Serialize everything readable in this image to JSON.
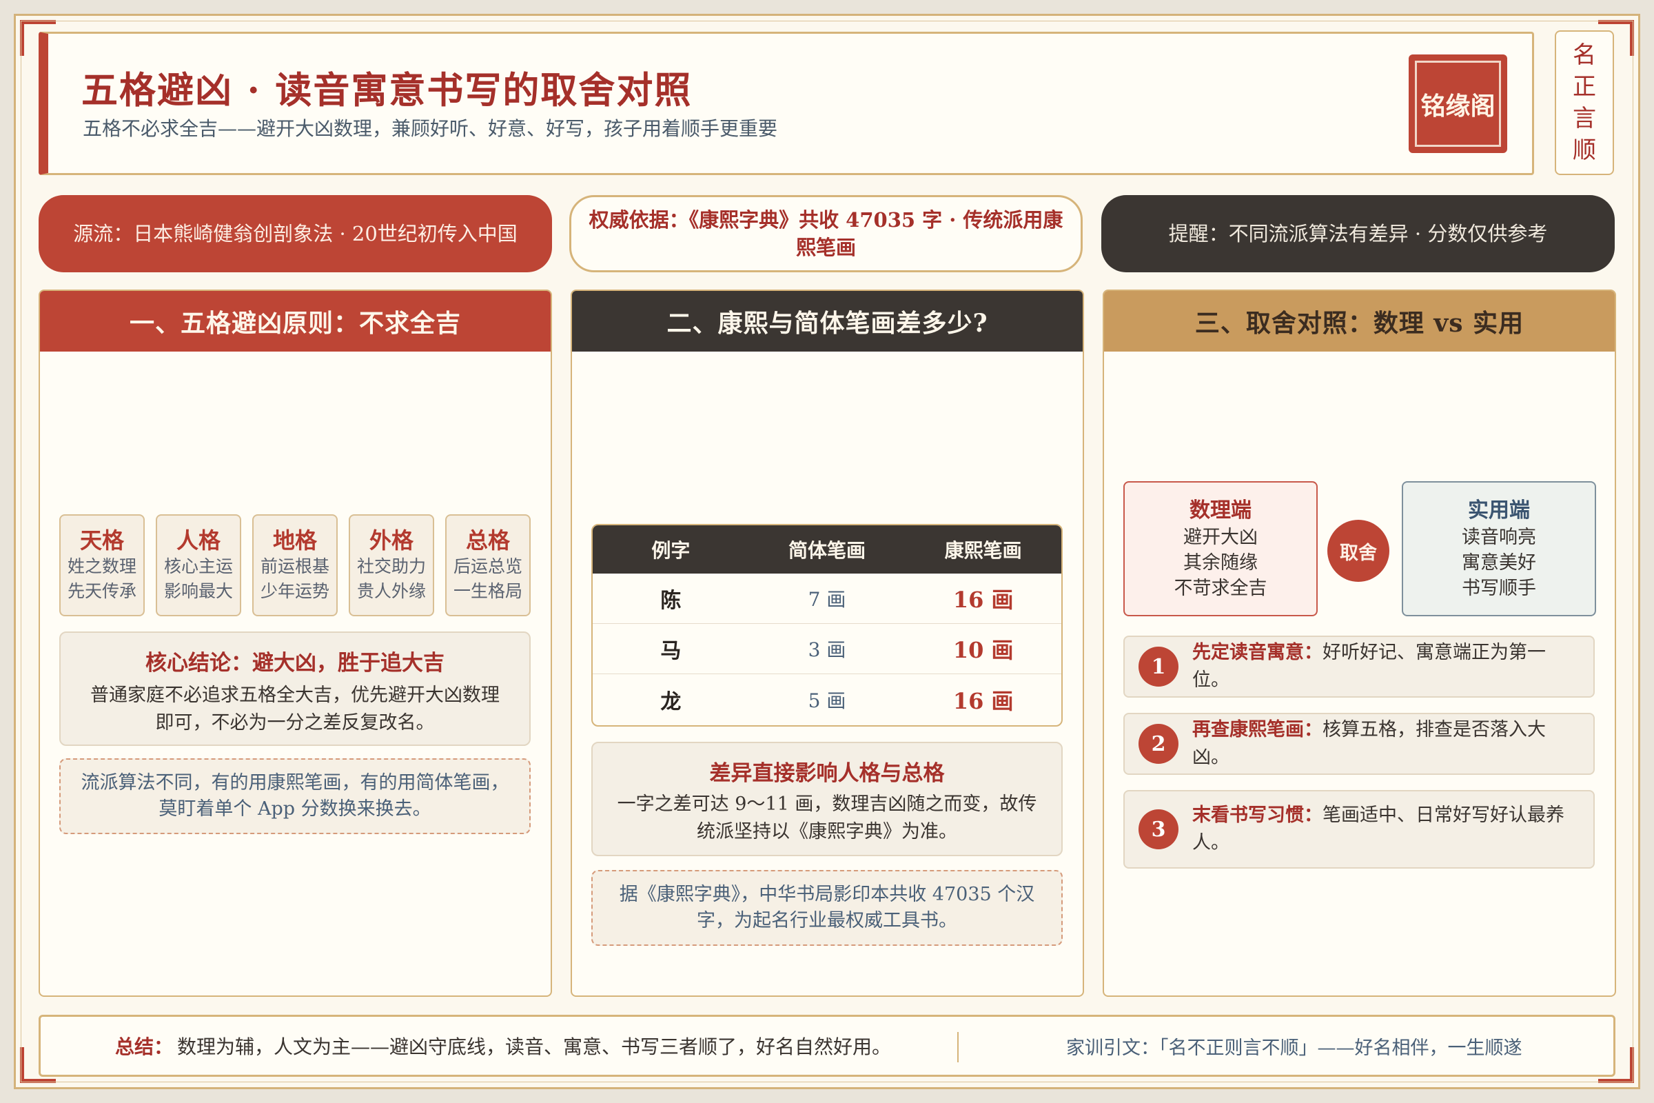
{
  "header": {
    "title": "五格避凶 · 读音寓意书写的取舍对照",
    "subtitle": "五格不必求全吉——避开大凶数理，兼顾好听、好意、好写，孩子用着顺手更重要",
    "seal": "铭缘阁",
    "side_tag": [
      "名",
      "正",
      "言",
      "顺"
    ]
  },
  "pills": {
    "origin": "源流：日本熊崎健翁创剖象法 · 20世纪初传入中国",
    "authority": "权威依据：《康熙字典》共收 47035 字 · 传统派用康熙笔画",
    "reminder": "提醒：不同流派算法有差异 · 分数仅供参考"
  },
  "panel1": {
    "title": "一、五格避凶原则：不求全吉",
    "grids": [
      {
        "name": "天格",
        "line1": "姓之数理",
        "line2": "先天传承"
      },
      {
        "name": "人格",
        "line1": "核心主运",
        "line2": "影响最大"
      },
      {
        "name": "地格",
        "line1": "前运根基",
        "line2": "少年运势"
      },
      {
        "name": "外格",
        "line1": "社交助力",
        "line2": "贵人外缘"
      },
      {
        "name": "总格",
        "line1": "后运总览",
        "line2": "一生格局"
      }
    ],
    "core_title": "核心结论：避大凶，胜于追大吉",
    "core_text": "普通家庭不必追求五格全大吉，优先避开大凶数理即可，不必为一分之差反复改名。",
    "note": "流派算法不同，有的用康熙笔画，有的用简体笔画，莫盯着单个 App 分数换来换去。"
  },
  "panel2": {
    "title": "二、康熙与简体笔画差多少?",
    "table_headers": [
      "例字",
      "简体笔画",
      "康熙笔画"
    ],
    "rows": [
      {
        "char": "陈",
        "simple": "7 画",
        "kangxi": "16 画"
      },
      {
        "char": "马",
        "simple": "3 画",
        "kangxi": "10 画"
      },
      {
        "char": "龙",
        "simple": "5 画",
        "kangxi": "16 画"
      }
    ],
    "diff_title": "差异直接影响人格与总格",
    "diff_text": "一字之差可达 9～11 画，数理吉凶随之而变，故传统派坚持以《康熙字典》为准。",
    "note": "据《康熙字典》，中华书局影印本共收 47035 个汉字，为起名行业最权威工具书。"
  },
  "panel3": {
    "title": "三、取舍对照：数理 vs 实用",
    "left": {
      "title": "数理端",
      "lines": [
        "避开大凶",
        "其余随缘",
        "不苛求全吉"
      ]
    },
    "center": "取舍",
    "right": {
      "title": "实用端",
      "lines": [
        "读音响亮",
        "寓意美好",
        "书写顺手"
      ]
    },
    "steps": [
      {
        "num": "1",
        "key": "先定读音寓意：",
        "text": "好听好记、寓意端正为第一位。"
      },
      {
        "num": "2",
        "key": "再查康熙笔画：",
        "text": "核算五格，排查是否落入大凶。"
      },
      {
        "num": "3",
        "key": "末看书写习惯：",
        "text": "笔画适中、日常好写好认最养人。"
      }
    ]
  },
  "footer": {
    "key": "总结：",
    "summary": "数理为辅，人文为主——避凶守底线，读音、寓意、书写三者顺了，好名自然好用。",
    "quote": "家训引文：「名不正则言不顺」——好名相伴，一生顺遂"
  },
  "colors": {
    "accent_red": "#bd4535",
    "dark": "#3b3632",
    "gold": "#c99b5e",
    "border": "#d6b47a"
  }
}
